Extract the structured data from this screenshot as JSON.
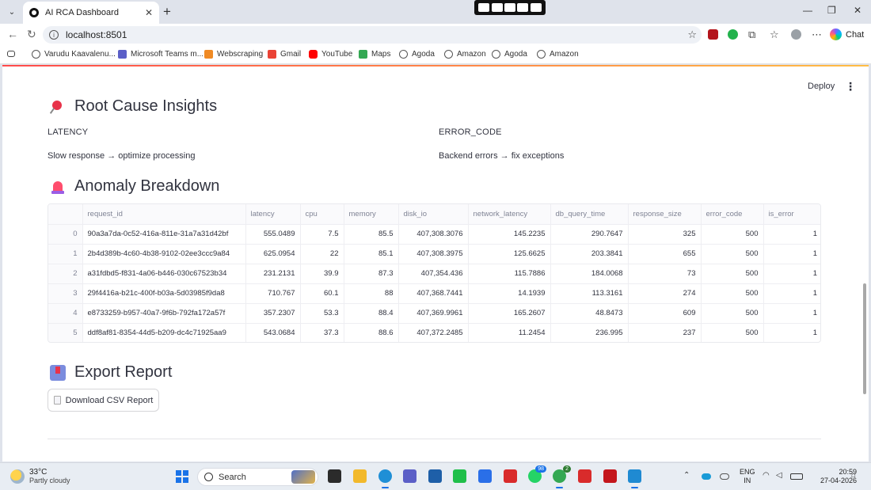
{
  "browser": {
    "tab_title": "AI RCA Dashboard",
    "url": "localhost:8501",
    "chat_label": "Chat",
    "bookmarks": [
      "Varudu Kaavalenu...",
      "Microsoft Teams m...",
      "Webscraping",
      "Gmail",
      "YouTube",
      "Maps",
      "Agoda",
      "Amazon",
      "Agoda",
      "Amazon"
    ]
  },
  "app": {
    "deploy_label": "Deploy",
    "insights": {
      "heading": "Root Cause Insights",
      "items": [
        {
          "key": "LATENCY",
          "value": "Slow response → optimize processing"
        },
        {
          "key": "ERROR_CODE",
          "value": "Backend errors → fix exceptions"
        }
      ]
    },
    "anomaly": {
      "heading": "Anomaly Breakdown",
      "columns": [
        "",
        "request_id",
        "latency",
        "cpu",
        "memory",
        "disk_io",
        "network_latency",
        "db_query_time",
        "response_size",
        "error_code",
        "is_error"
      ],
      "rows": [
        [
          "0",
          "90a3a7da-0c52-416a-811e-31a7a31d42bf",
          "555.0489",
          "7.5",
          "85.5",
          "407,308.3076",
          "145.2235",
          "290.7647",
          "325",
          "500",
          "1"
        ],
        [
          "1",
          "2b4d389b-4c60-4b38-9102-02ee3ccc9a84",
          "625.0954",
          "22",
          "85.1",
          "407,308.3975",
          "125.6625",
          "203.3841",
          "655",
          "500",
          "1"
        ],
        [
          "2",
          "a31fdbd5-f831-4a06-b446-030c67523b34",
          "231.2131",
          "39.9",
          "87.3",
          "407,354.436",
          "115.7886",
          "184.0068",
          "73",
          "500",
          "1"
        ],
        [
          "3",
          "29f4416a-b21c-400f-b03a-5d03985f9da8",
          "710.767",
          "60.1",
          "88",
          "407,368.7441",
          "14.1939",
          "113.3161",
          "274",
          "500",
          "1"
        ],
        [
          "4",
          "e8733259-b957-40a7-9f6b-792fa172a57f",
          "357.2307",
          "53.3",
          "88.4",
          "407,369.9961",
          "165.2607",
          "48.8473",
          "609",
          "500",
          "1"
        ],
        [
          "5",
          "ddf8af81-8354-44d5-b209-dc4c71925aa9",
          "543.0684",
          "37.3",
          "88.6",
          "407,372.2485",
          "11.2454",
          "236.995",
          "237",
          "500",
          "1"
        ]
      ]
    },
    "export": {
      "heading": "Export Report",
      "button_label": "Download CSV Report"
    }
  },
  "taskbar": {
    "temperature": "33°C",
    "weather": "Partly cloudy",
    "search_placeholder": "Search",
    "whatsapp_badge": "98",
    "chrome_badge": "2",
    "lang_1": "ENG",
    "lang_2": "IN",
    "time": "20:59",
    "date": "27-04-2026"
  }
}
